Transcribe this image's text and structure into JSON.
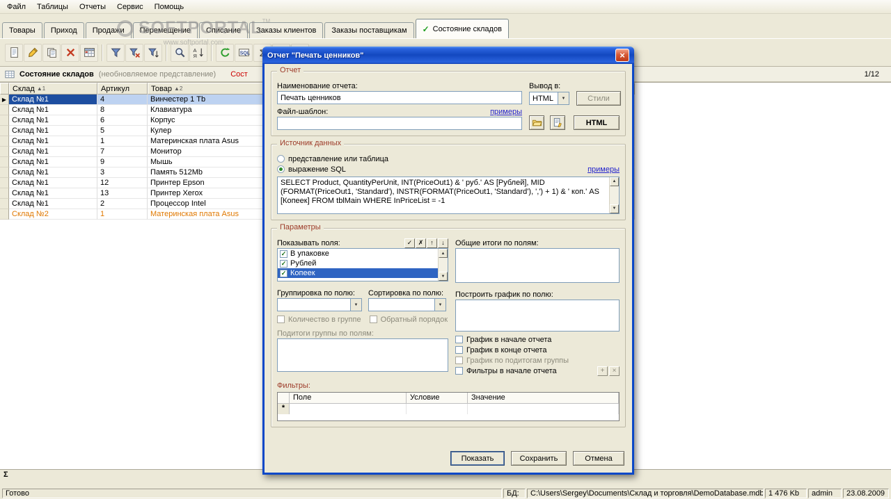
{
  "glyphs": {
    "check": "✓",
    "up_arrow": "▲",
    "down_arrow": "▼",
    "dropdown_arrow": "▼"
  },
  "menu": {
    "items": [
      "Файл",
      "Таблицы",
      "Отчеты",
      "Сервис",
      "Помощь"
    ]
  },
  "watermark": {
    "title": "SOFTPORTAL",
    "tm": "TM",
    "subtitle": "www.softportal.com"
  },
  "tabs": {
    "active_check": "✓",
    "items": [
      {
        "label": "Товары",
        "active": false
      },
      {
        "label": "Приход",
        "active": false
      },
      {
        "label": "Продажи",
        "active": false
      },
      {
        "label": "Перемещение",
        "active": false
      },
      {
        "label": "Списание",
        "active": false
      },
      {
        "label": "Заказы клиентов",
        "active": false
      },
      {
        "label": "Заказы поставщикам",
        "active": false
      },
      {
        "label": "Состояние складов",
        "active": true
      }
    ]
  },
  "toolbar": {
    "icons": [
      {
        "name": "new-record"
      },
      {
        "name": "edit-record"
      },
      {
        "name": "copy-record"
      },
      {
        "name": "delete-record"
      },
      {
        "name": "table-views"
      },
      {
        "name": "filter"
      },
      {
        "name": "filter-clear"
      },
      {
        "name": "filter-sort"
      },
      {
        "name": "search"
      },
      {
        "name": "sort-az"
      },
      {
        "name": "refresh"
      },
      {
        "name": "sql-editor"
      },
      {
        "name": "sum"
      },
      {
        "name": "calculator"
      },
      {
        "name": "chart"
      }
    ],
    "separators_after": [
      4,
      7,
      9
    ]
  },
  "view_header": {
    "title": "Состояние складов",
    "subtitle": "(необновляемое представление)",
    "overlay_text": "Сост",
    "page_indicator": "1/12"
  },
  "grid": {
    "selected_marker": "▶",
    "columns": [
      {
        "label": "Склад",
        "sort_badge": "▲1"
      },
      {
        "label": "Артикул",
        "sort_badge": ""
      },
      {
        "label": "Товар",
        "sort_badge": "▲2"
      }
    ],
    "rows": [
      {
        "cells": [
          "Склад №1",
          "4",
          "Винчестер 1 Tb"
        ],
        "state": "selected"
      },
      {
        "cells": [
          "Склад №1",
          "8",
          "Клавиатура"
        ],
        "state": "normal"
      },
      {
        "cells": [
          "Склад №1",
          "6",
          "Корпус"
        ],
        "state": "normal"
      },
      {
        "cells": [
          "Склад №1",
          "5",
          "Кулер"
        ],
        "state": "normal"
      },
      {
        "cells": [
          "Склад №1",
          "1",
          "Материнская плата Asus"
        ],
        "state": "normal"
      },
      {
        "cells": [
          "Склад №1",
          "7",
          "Монитор"
        ],
        "state": "normal"
      },
      {
        "cells": [
          "Склад №1",
          "9",
          "Мышь"
        ],
        "state": "normal"
      },
      {
        "cells": [
          "Склад №1",
          "3",
          "Память 512Mb"
        ],
        "state": "normal"
      },
      {
        "cells": [
          "Склад №1",
          "12",
          "Принтер Epson"
        ],
        "state": "normal"
      },
      {
        "cells": [
          "Склад №1",
          "13",
          "Принтер Xerox"
        ],
        "state": "normal"
      },
      {
        "cells": [
          "Склад №1",
          "2",
          "Процессор Intel"
        ],
        "state": "normal"
      },
      {
        "cells": [
          "Склад №2",
          "1",
          "Материнская плата Asus"
        ],
        "state": "orange"
      }
    ],
    "footer_sigma": "Σ"
  },
  "dialog": {
    "title": "Отчет \"Печать ценников\"",
    "close_glyph": "×",
    "report": {
      "group_title": "Отчет",
      "name_label": "Наименование отчета:",
      "name_value": "Печать ценников",
      "output_label": "Вывод в:",
      "output_value": "HTML",
      "styles_button": "Стили",
      "template_label": "Файл-шаблон:",
      "template_value": "",
      "examples_link": "примеры",
      "html_button": "HTML"
    },
    "source": {
      "group_title": "Источник данных",
      "option_view": "представление или таблица",
      "option_sql": "выражение SQL",
      "examples_link": "примеры",
      "sql": "SELECT Product, QuantityPerUnit, INT(PriceOut1) & ' руб.' AS [Рублей], MID (FORMAT(PriceOut1, 'Standard'), INSTR(FORMAT(PriceOut1, 'Standard'), ',') + 1) & ' коп.' AS [Копеек] FROM tblMain WHERE InPriceList = -1"
    },
    "params": {
      "group_title": "Параметры",
      "show_fields_label": "Показывать поля:",
      "field_buttons": [
        "check-all",
        "uncheck-all",
        "move-up",
        "move-down"
      ],
      "fields": [
        {
          "label": "В упаковке",
          "checked": true,
          "selected": false
        },
        {
          "label": "Рублей",
          "checked": true,
          "selected": false
        },
        {
          "label": "Копеек",
          "checked": true,
          "selected": true
        }
      ],
      "totals_label": "Общие итоги по полям:",
      "grouping_label": "Группировка по полю:",
      "sorting_label": "Сортировка по полю:",
      "chart_field_label": "Построить график по полю:",
      "count_in_group_label": "Количество в группе",
      "reverse_order_label": "Обратный порядок",
      "subtotals_label": "Подитоги группы по полям:",
      "chart_start_label": "График в начале отчета",
      "chart_end_label": "График в конце отчета",
      "chart_subtotals_label": "График по подитогам группы",
      "filters_start_label": "Фильтры в начале отчета",
      "filter_buttons": [
        "add-filter",
        "delete-filter"
      ],
      "filters_label": "Фильтры:",
      "filters_columns": [
        "Поле",
        "Условие",
        "Значение"
      ],
      "filters_new_row_marker": "*"
    },
    "buttons": {
      "show": "Показать",
      "save": "Сохранить",
      "cancel": "Отмена"
    }
  },
  "statusbar": {
    "status": "Готово",
    "db_label": "БД:",
    "db_path": "C:\\Users\\Sergey\\Documents\\Склад и торговля\\DemoDatabase.mdb",
    "db_size": "1 476 Kb",
    "user": "admin",
    "date": "23.08.2009"
  }
}
